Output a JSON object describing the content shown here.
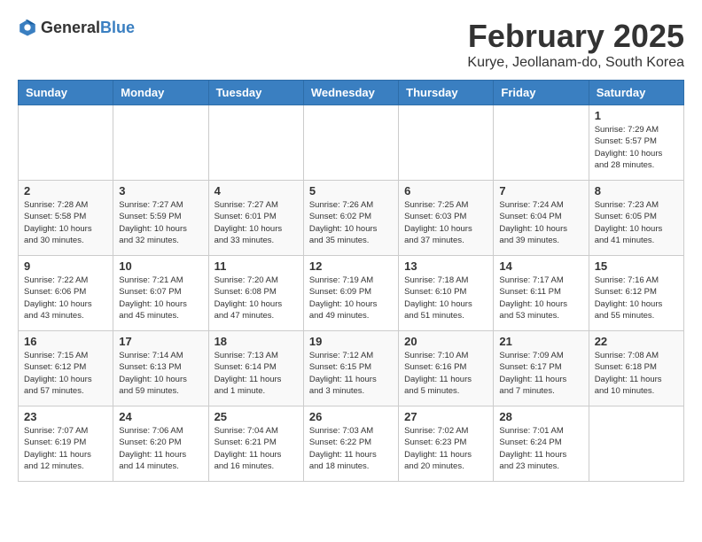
{
  "header": {
    "logo_general": "General",
    "logo_blue": "Blue",
    "month_title": "February 2025",
    "location": "Kurye, Jeollanam-do, South Korea"
  },
  "weekdays": [
    "Sunday",
    "Monday",
    "Tuesday",
    "Wednesday",
    "Thursday",
    "Friday",
    "Saturday"
  ],
  "weeks": [
    [
      {
        "day": "",
        "info": ""
      },
      {
        "day": "",
        "info": ""
      },
      {
        "day": "",
        "info": ""
      },
      {
        "day": "",
        "info": ""
      },
      {
        "day": "",
        "info": ""
      },
      {
        "day": "",
        "info": ""
      },
      {
        "day": "1",
        "info": "Sunrise: 7:29 AM\nSunset: 5:57 PM\nDaylight: 10 hours\nand 28 minutes."
      }
    ],
    [
      {
        "day": "2",
        "info": "Sunrise: 7:28 AM\nSunset: 5:58 PM\nDaylight: 10 hours\nand 30 minutes."
      },
      {
        "day": "3",
        "info": "Sunrise: 7:27 AM\nSunset: 5:59 PM\nDaylight: 10 hours\nand 32 minutes."
      },
      {
        "day": "4",
        "info": "Sunrise: 7:27 AM\nSunset: 6:01 PM\nDaylight: 10 hours\nand 33 minutes."
      },
      {
        "day": "5",
        "info": "Sunrise: 7:26 AM\nSunset: 6:02 PM\nDaylight: 10 hours\nand 35 minutes."
      },
      {
        "day": "6",
        "info": "Sunrise: 7:25 AM\nSunset: 6:03 PM\nDaylight: 10 hours\nand 37 minutes."
      },
      {
        "day": "7",
        "info": "Sunrise: 7:24 AM\nSunset: 6:04 PM\nDaylight: 10 hours\nand 39 minutes."
      },
      {
        "day": "8",
        "info": "Sunrise: 7:23 AM\nSunset: 6:05 PM\nDaylight: 10 hours\nand 41 minutes."
      }
    ],
    [
      {
        "day": "9",
        "info": "Sunrise: 7:22 AM\nSunset: 6:06 PM\nDaylight: 10 hours\nand 43 minutes."
      },
      {
        "day": "10",
        "info": "Sunrise: 7:21 AM\nSunset: 6:07 PM\nDaylight: 10 hours\nand 45 minutes."
      },
      {
        "day": "11",
        "info": "Sunrise: 7:20 AM\nSunset: 6:08 PM\nDaylight: 10 hours\nand 47 minutes."
      },
      {
        "day": "12",
        "info": "Sunrise: 7:19 AM\nSunset: 6:09 PM\nDaylight: 10 hours\nand 49 minutes."
      },
      {
        "day": "13",
        "info": "Sunrise: 7:18 AM\nSunset: 6:10 PM\nDaylight: 10 hours\nand 51 minutes."
      },
      {
        "day": "14",
        "info": "Sunrise: 7:17 AM\nSunset: 6:11 PM\nDaylight: 10 hours\nand 53 minutes."
      },
      {
        "day": "15",
        "info": "Sunrise: 7:16 AM\nSunset: 6:12 PM\nDaylight: 10 hours\nand 55 minutes."
      }
    ],
    [
      {
        "day": "16",
        "info": "Sunrise: 7:15 AM\nSunset: 6:12 PM\nDaylight: 10 hours\nand 57 minutes."
      },
      {
        "day": "17",
        "info": "Sunrise: 7:14 AM\nSunset: 6:13 PM\nDaylight: 10 hours\nand 59 minutes."
      },
      {
        "day": "18",
        "info": "Sunrise: 7:13 AM\nSunset: 6:14 PM\nDaylight: 11 hours\nand 1 minute."
      },
      {
        "day": "19",
        "info": "Sunrise: 7:12 AM\nSunset: 6:15 PM\nDaylight: 11 hours\nand 3 minutes."
      },
      {
        "day": "20",
        "info": "Sunrise: 7:10 AM\nSunset: 6:16 PM\nDaylight: 11 hours\nand 5 minutes."
      },
      {
        "day": "21",
        "info": "Sunrise: 7:09 AM\nSunset: 6:17 PM\nDaylight: 11 hours\nand 7 minutes."
      },
      {
        "day": "22",
        "info": "Sunrise: 7:08 AM\nSunset: 6:18 PM\nDaylight: 11 hours\nand 10 minutes."
      }
    ],
    [
      {
        "day": "23",
        "info": "Sunrise: 7:07 AM\nSunset: 6:19 PM\nDaylight: 11 hours\nand 12 minutes."
      },
      {
        "day": "24",
        "info": "Sunrise: 7:06 AM\nSunset: 6:20 PM\nDaylight: 11 hours\nand 14 minutes."
      },
      {
        "day": "25",
        "info": "Sunrise: 7:04 AM\nSunset: 6:21 PM\nDaylight: 11 hours\nand 16 minutes."
      },
      {
        "day": "26",
        "info": "Sunrise: 7:03 AM\nSunset: 6:22 PM\nDaylight: 11 hours\nand 18 minutes."
      },
      {
        "day": "27",
        "info": "Sunrise: 7:02 AM\nSunset: 6:23 PM\nDaylight: 11 hours\nand 20 minutes."
      },
      {
        "day": "28",
        "info": "Sunrise: 7:01 AM\nSunset: 6:24 PM\nDaylight: 11 hours\nand 23 minutes."
      },
      {
        "day": "",
        "info": ""
      }
    ]
  ]
}
